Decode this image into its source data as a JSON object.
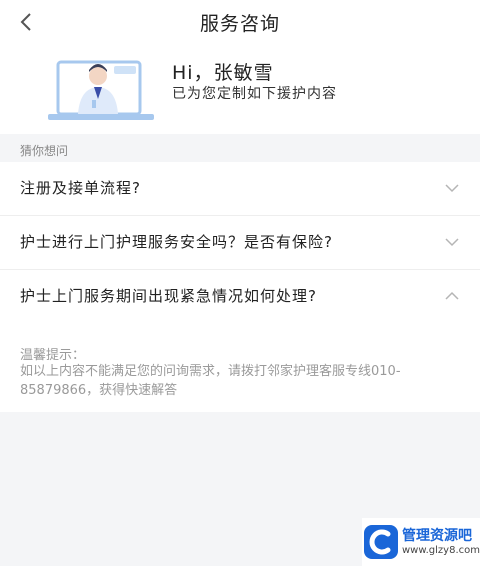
{
  "header": {
    "title": "服务咨询"
  },
  "profile": {
    "greeting": "Hi，张敏雪",
    "subtitle": "已为您定制如下援护内容"
  },
  "section": {
    "label": "猜你想问"
  },
  "faq": [
    {
      "question": "注册及接单流程?",
      "expanded": false
    },
    {
      "question": "护士进行上门护理服务安全吗？是否有保险?",
      "expanded": false
    },
    {
      "question": "护士上门服务期间出现紧急情况如何处理?",
      "expanded": true
    }
  ],
  "answer": {
    "title": "温馨提示：",
    "body": "如以上内容不能满足您的问询需求，请拨打邻家护理客服专线010-85879866，获得快速解答"
  },
  "watermark": {
    "name": "管理资源吧",
    "url": "www.glzy8.com"
  },
  "colors": {
    "accent": "#1a66d8",
    "illustration": "#a7c8ee"
  }
}
